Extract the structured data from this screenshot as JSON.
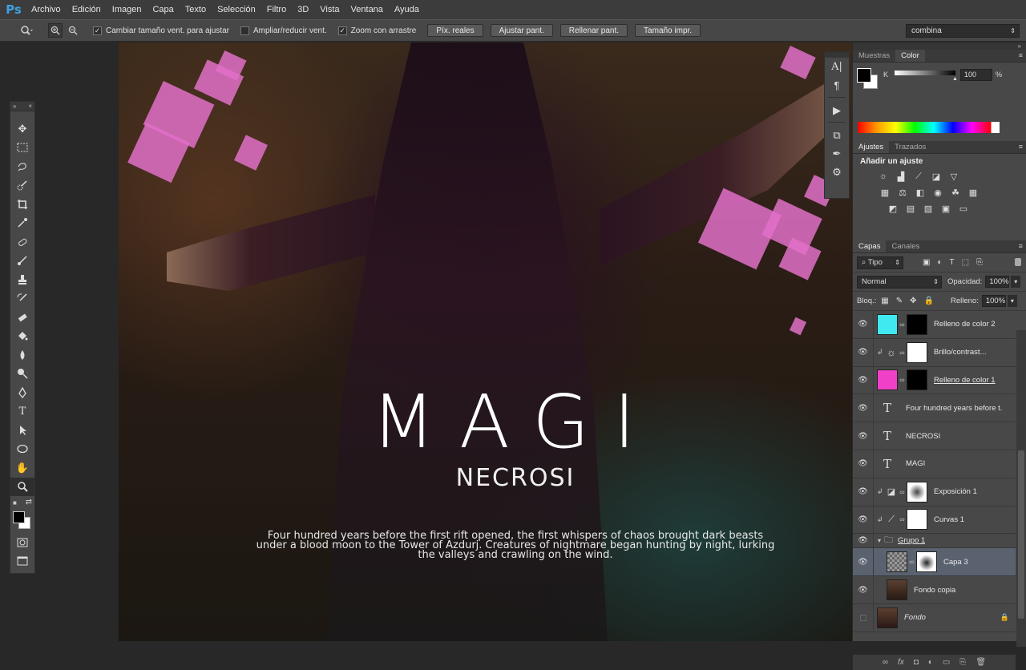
{
  "app": {
    "logo": "Ps"
  },
  "menu": [
    "Archivo",
    "Edición",
    "Imagen",
    "Capa",
    "Texto",
    "Selección",
    "Filtro",
    "3D",
    "Vista",
    "Ventana",
    "Ayuda"
  ],
  "options": {
    "zoom_icon": "magnifier-icon",
    "checks": [
      {
        "label": "Cambiar tamaño vent. para ajustar",
        "checked": true
      },
      {
        "label": "Ampliar/reducir vent.",
        "checked": false
      },
      {
        "label": "Zoom con arrastre",
        "checked": true
      }
    ],
    "buttons": [
      "Píx. reales",
      "Ajustar pant.",
      "Rellenar pant.",
      "Tamaño impr."
    ],
    "workspace": "combina"
  },
  "canvas": {
    "title": "MAGI",
    "subtitle": "NECROSI",
    "blurb": "Four hundred years before the first rift opened, the first whispers of chaos brought dark beasts under a blood moon to the Tower of Azdurj. Creatures of nightmare began hunting by night, lurking the valleys and crawling on the wind."
  },
  "color_panel": {
    "tabs": [
      "Muestras",
      "Color"
    ],
    "active_tab": "Color",
    "channel": "K",
    "value": "100",
    "unit": "%"
  },
  "adjust_panel": {
    "tabs": [
      "Ajustes",
      "Trazados"
    ],
    "active_tab": "Ajustes",
    "title": "Añadir un ajuste"
  },
  "layers_panel": {
    "tabs": [
      "Capas",
      "Canales"
    ],
    "active_tab": "Capas",
    "filter": "Tipo",
    "blend_mode": "Normal",
    "opacity_label": "Opacidad:",
    "opacity": "100%",
    "lock_label": "Bloq.:",
    "fill_label": "Relleno:",
    "fill": "100%",
    "layers": [
      {
        "name": "Relleno de color 2",
        "kind": "fill",
        "thumb": "#40e8f0",
        "mask": "#000",
        "visible": true
      },
      {
        "name": "Brillo/contrast...",
        "kind": "adjust",
        "mask": "#fff",
        "visible": true,
        "clipped": true
      },
      {
        "name": "Relleno de color 1",
        "kind": "fill",
        "thumb": "#f040c8",
        "mask": "#000",
        "visible": true
      },
      {
        "name": "Four hundred years before t...",
        "kind": "text",
        "visible": true
      },
      {
        "name": "NECROSI",
        "kind": "text",
        "visible": true
      },
      {
        "name": "MAGI",
        "kind": "text",
        "visible": true
      },
      {
        "name": "Exposición 1",
        "kind": "adjust",
        "mask": "#ccc",
        "visible": true,
        "clipped": true
      },
      {
        "name": "Curvas 1",
        "kind": "adjust",
        "mask": "#fff",
        "visible": true,
        "clipped": true
      },
      {
        "name": "Grupo 1",
        "kind": "group",
        "visible": true
      },
      {
        "name": "Capa 3",
        "kind": "pixel",
        "mask": "#ddd",
        "visible": true,
        "selected": true
      },
      {
        "name": "Fondo copia",
        "kind": "pixel",
        "visible": true
      },
      {
        "name": "Fondo",
        "kind": "background",
        "visible": false
      }
    ]
  }
}
